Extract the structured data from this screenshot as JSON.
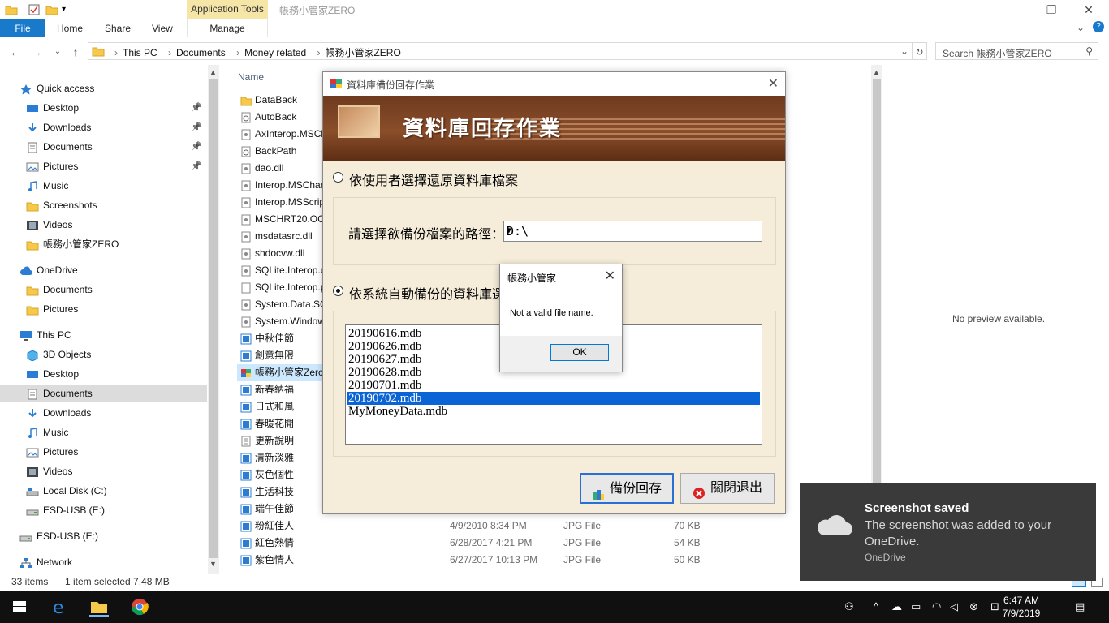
{
  "window": {
    "title": "帳務小管家ZERO",
    "app_tools": "Application Tools"
  },
  "ribbon": {
    "tabs": [
      "File",
      "Home",
      "Share",
      "View",
      "Manage"
    ]
  },
  "address": {
    "crumbs": [
      "This PC",
      "Documents",
      "Money related",
      "帳務小管家ZERO"
    ],
    "search_placeholder": "Search 帳務小管家ZERO"
  },
  "nav": {
    "items": [
      {
        "label": "Quick access",
        "icon": "star-icon",
        "indent": 1
      },
      {
        "label": "Desktop",
        "icon": "desktop-icon",
        "indent": 2,
        "pinned": true
      },
      {
        "label": "Downloads",
        "icon": "download-icon",
        "indent": 2,
        "pinned": true
      },
      {
        "label": "Documents",
        "icon": "documents-icon",
        "indent": 2,
        "pinned": true
      },
      {
        "label": "Pictures",
        "icon": "pictures-icon",
        "indent": 2,
        "pinned": true
      },
      {
        "label": "Music",
        "icon": "music-icon",
        "indent": 2
      },
      {
        "label": "Screenshots",
        "icon": "folder-icon",
        "indent": 2
      },
      {
        "label": "Videos",
        "icon": "videos-icon",
        "indent": 2
      },
      {
        "label": "帳務小管家ZERO",
        "icon": "folder-icon",
        "indent": 2
      },
      {
        "label": "OneDrive",
        "icon": "cloud-icon",
        "indent": 1
      },
      {
        "label": "Documents",
        "icon": "folder-icon",
        "indent": 2
      },
      {
        "label": "Pictures",
        "icon": "folder-icon",
        "indent": 2
      },
      {
        "label": "This PC",
        "icon": "pc-icon",
        "indent": 1
      },
      {
        "label": "3D Objects",
        "icon": "cube-icon",
        "indent": 2
      },
      {
        "label": "Desktop",
        "icon": "desktop-icon",
        "indent": 2
      },
      {
        "label": "Documents",
        "icon": "documents-icon",
        "indent": 2,
        "selected": true
      },
      {
        "label": "Downloads",
        "icon": "download-icon",
        "indent": 2
      },
      {
        "label": "Music",
        "icon": "music-icon",
        "indent": 2
      },
      {
        "label": "Pictures",
        "icon": "pictures-icon",
        "indent": 2
      },
      {
        "label": "Videos",
        "icon": "videos-icon",
        "indent": 2
      },
      {
        "label": "Local Disk (C:)",
        "icon": "drive-icon",
        "indent": 2
      },
      {
        "label": "ESD-USB (E:)",
        "icon": "usb-icon",
        "indent": 2
      },
      {
        "label": "ESD-USB (E:)",
        "icon": "usb-icon",
        "indent": 1
      },
      {
        "label": "Network",
        "icon": "network-icon",
        "indent": 1
      }
    ]
  },
  "filelist": {
    "column_name": "Name",
    "files": [
      {
        "name": "DataBack",
        "icon": "folder-icon"
      },
      {
        "name": "AutoBack",
        "icon": "gear-file-icon"
      },
      {
        "name": "AxInterop.MSCh",
        "icon": "dll-icon"
      },
      {
        "name": "BackPath",
        "icon": "gear-file-icon"
      },
      {
        "name": "dao.dll",
        "icon": "dll-icon"
      },
      {
        "name": "Interop.MSChar",
        "icon": "dll-icon"
      },
      {
        "name": "Interop.MSScrip",
        "icon": "dll-icon"
      },
      {
        "name": "MSCHRT20.OCX",
        "icon": "dll-icon"
      },
      {
        "name": "msdatasrc.dll",
        "icon": "dll-icon"
      },
      {
        "name": "shdocvw.dll",
        "icon": "dll-icon"
      },
      {
        "name": "SQLite.Interop.d",
        "icon": "dll-icon"
      },
      {
        "name": "SQLite.Interop.p",
        "icon": "file-icon"
      },
      {
        "name": "System.Data.SQ",
        "icon": "dll-icon"
      },
      {
        "name": "System.Window",
        "icon": "dll-icon"
      },
      {
        "name": "中秋佳節",
        "icon": "image-icon"
      },
      {
        "name": "創意無限",
        "icon": "image-icon"
      },
      {
        "name": "帳務小管家Zero",
        "icon": "app-icon",
        "selected": true
      },
      {
        "name": "新春納福",
        "icon": "image-icon"
      },
      {
        "name": "日式和風",
        "icon": "image-icon"
      },
      {
        "name": "春暖花開",
        "icon": "image-icon"
      },
      {
        "name": "更新說明",
        "icon": "text-icon"
      },
      {
        "name": "清新淡雅",
        "icon": "image-icon"
      },
      {
        "name": "灰色個性",
        "icon": "image-icon"
      },
      {
        "name": "生活科技",
        "icon": "image-icon"
      },
      {
        "name": "端午佳節",
        "icon": "image-icon"
      },
      {
        "name": "粉紅佳人",
        "icon": "image-icon",
        "date": "4/9/2010 8:34 PM",
        "type": "JPG File",
        "size": "70 KB"
      },
      {
        "name": "紅色熱情",
        "icon": "image-icon",
        "date": "6/28/2017 4:21 PM",
        "type": "JPG File",
        "size": "54 KB"
      },
      {
        "name": "紫色情人",
        "icon": "image-icon",
        "date": "6/27/2017 10:13 PM",
        "type": "JPG File",
        "size": "50 KB"
      }
    ]
  },
  "preview": {
    "text": "No preview available."
  },
  "status": {
    "items": "33 items",
    "selected": "1 item selected  7.48 MB"
  },
  "dialog": {
    "title": "資料庫備份回存作業",
    "banner_title": "資料庫回存作業",
    "option1": "依使用者選擇還原資料庫檔案",
    "path_label": "請選擇欲備份檔案的路徑：",
    "path_value": "D:\\",
    "option2": "依系統自動備份的資料庫選",
    "files": [
      "20190616.mdb",
      "20190626.mdb",
      "20190627.mdb",
      "20190628.mdb",
      "20190701.mdb",
      "20190702.mdb",
      "MyMoneyData.mdb"
    ],
    "selected_index": 5,
    "btn_restore": "備份回存",
    "btn_close": "關閉退出"
  },
  "msgbox": {
    "title": "帳務小管家",
    "message": "Not a valid file name.",
    "ok": "OK"
  },
  "toast": {
    "title": "Screenshot saved",
    "body": "The screenshot was added to your OneDrive.",
    "source": "OneDrive"
  },
  "taskbar": {
    "time": "6:47 AM",
    "date": "7/9/2019"
  },
  "colors": {
    "accent": "#1979ca",
    "selection": "#0a64d6",
    "dialog_bg": "#f5ecd9",
    "banner": "#7a4222"
  }
}
